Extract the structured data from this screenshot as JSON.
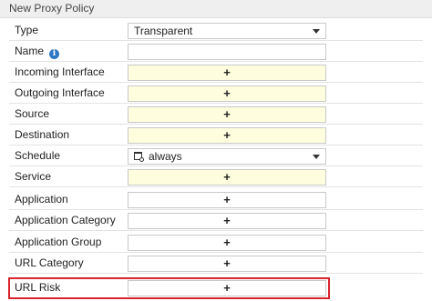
{
  "window": {
    "title": "New Proxy Policy"
  },
  "form": {
    "type": {
      "label": "Type",
      "value": "Transparent"
    },
    "name": {
      "label": "Name",
      "value": ""
    },
    "incoming_interface": {
      "label": "Incoming Interface",
      "add_symbol": "+"
    },
    "outgoing_interface": {
      "label": "Outgoing Interface",
      "add_symbol": "+"
    },
    "source": {
      "label": "Source",
      "add_symbol": "+"
    },
    "destination": {
      "label": "Destination",
      "add_symbol": "+"
    },
    "schedule": {
      "label": "Schedule",
      "value": "always"
    },
    "service": {
      "label": "Service",
      "add_symbol": "+"
    },
    "application": {
      "label": "Application",
      "add_symbol": "+"
    },
    "application_category": {
      "label": "Application Category",
      "add_symbol": "+"
    },
    "application_group": {
      "label": "Application Group",
      "add_symbol": "+"
    },
    "url_category": {
      "label": "URL Category",
      "add_symbol": "+"
    },
    "url_risk": {
      "label": "URL Risk",
      "add_symbol": "+"
    }
  },
  "colors": {
    "required_field_bg": "#fefedf",
    "highlight_border": "#d9232d",
    "info_icon": "#2f78c4"
  }
}
